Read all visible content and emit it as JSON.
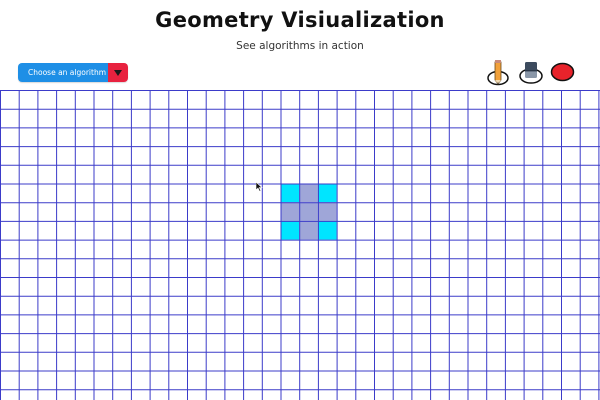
{
  "header": {
    "title": "Geometry Visiualization",
    "subtitle": "See algorithms in action"
  },
  "algorithm_select": {
    "label": "Choose an algorithm",
    "caret_icon": "triangle-down-icon",
    "colors": {
      "label_bg": "#1e8fe6",
      "caret_bg": "#e8223f"
    }
  },
  "toolbar": {
    "tools": [
      {
        "name": "pencil",
        "icon": "pencil-icon"
      },
      {
        "name": "eraser",
        "icon": "eraser-icon"
      },
      {
        "name": "color",
        "icon": "color-swatch-icon",
        "color": "#e8232b"
      }
    ]
  },
  "grid": {
    "line_color": "#3b3bc9",
    "columns": 32,
    "rows": 17,
    "cells": [
      {
        "row": 5,
        "col": 15,
        "color": "#00e5ff"
      },
      {
        "row": 5,
        "col": 16,
        "color": "#9fa6d8"
      },
      {
        "row": 5,
        "col": 17,
        "color": "#00e5ff"
      },
      {
        "row": 6,
        "col": 15,
        "color": "#9fa6d8"
      },
      {
        "row": 6,
        "col": 16,
        "color": "#9fa6d8"
      },
      {
        "row": 6,
        "col": 17,
        "color": "#9fa6d8"
      },
      {
        "row": 7,
        "col": 15,
        "color": "#00e5ff"
      },
      {
        "row": 7,
        "col": 16,
        "color": "#9fa6d8"
      },
      {
        "row": 7,
        "col": 17,
        "color": "#00e5ff"
      }
    ]
  }
}
